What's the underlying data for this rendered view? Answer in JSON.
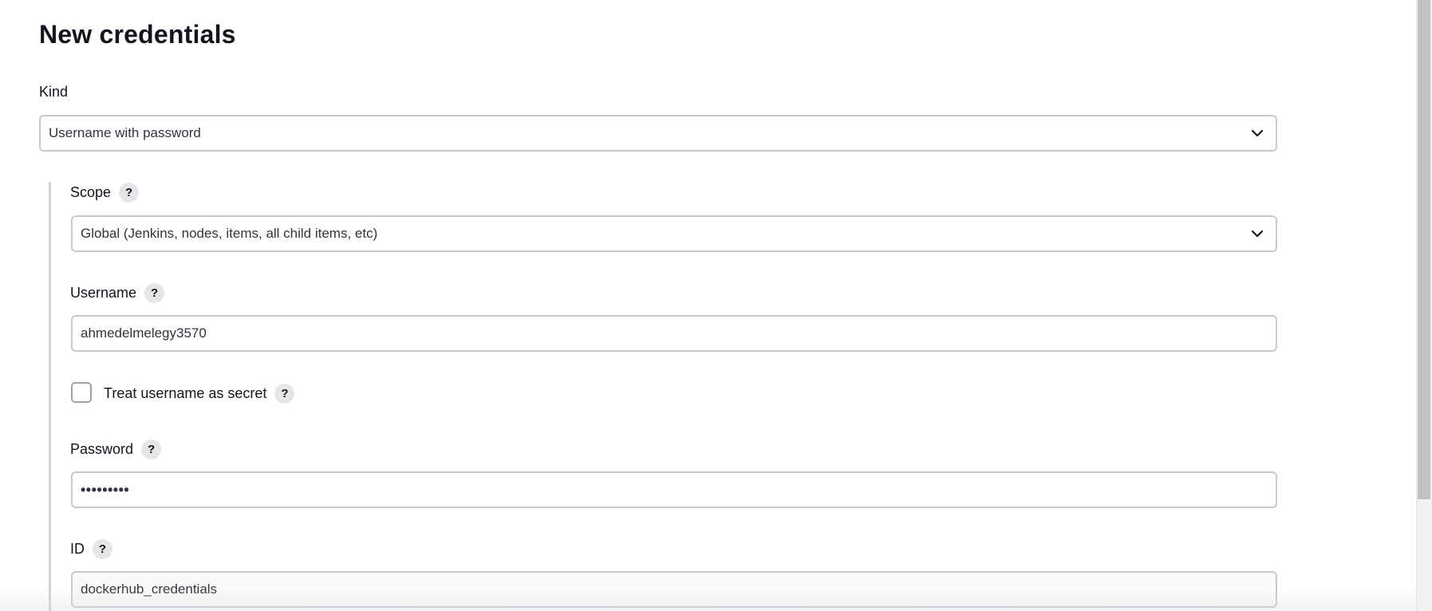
{
  "page": {
    "title": "New credentials"
  },
  "kind": {
    "label": "Kind",
    "selected": "Username with password",
    "icon": "chevron-down-icon"
  },
  "scope": {
    "label": "Scope",
    "help": "?",
    "selected": "Global (Jenkins, nodes, items, all child items, etc)",
    "icon": "chevron-down-icon"
  },
  "username": {
    "label": "Username",
    "help": "?",
    "value": "ahmedelmelegy3570"
  },
  "treat_secret": {
    "label": "Treat username as secret",
    "help": "?",
    "checked": false
  },
  "password": {
    "label": "Password",
    "help": "?",
    "value": "•••••••••"
  },
  "id": {
    "label": "ID",
    "help": "?",
    "value": "dockerhub_credentials"
  },
  "colors": {
    "text": "#14141f",
    "border": "#c3cbd0",
    "help_bg": "#e6e6e9",
    "section_bar": "#cfd3d7"
  }
}
